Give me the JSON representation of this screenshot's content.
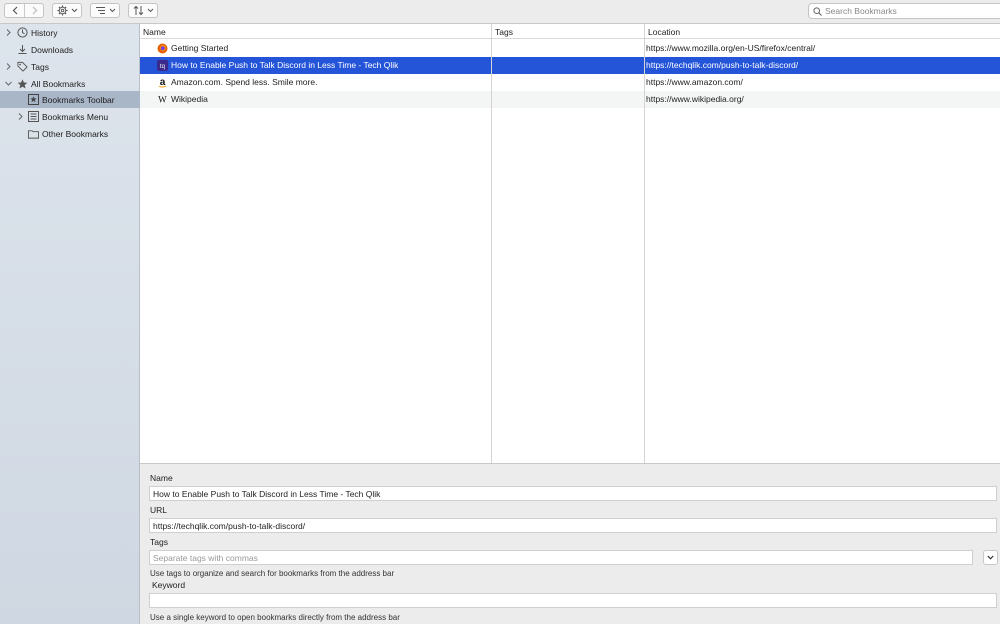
{
  "toolbar": {
    "back_icon": "chevron-left-icon",
    "forward_icon": "chevron-right-icon",
    "organize_icon": "gear-icon",
    "views_icon": "list-view-icon",
    "import_export_icon": "sort-arrows-icon",
    "search": {
      "placeholder": "Search Bookmarks",
      "value": ""
    }
  },
  "sidebar": {
    "items": [
      {
        "label": "History",
        "icon": "clock-icon",
        "disclosure": "collapsed"
      },
      {
        "label": "Downloads",
        "icon": "download-icon",
        "disclosure": "none"
      },
      {
        "label": "Tags",
        "icon": "tag-icon",
        "disclosure": "collapsed"
      },
      {
        "label": "All Bookmarks",
        "icon": "star-icon",
        "disclosure": "expanded"
      },
      {
        "label": "Bookmarks Toolbar",
        "icon": "bookmarks-toolbar-icon",
        "disclosure": "none",
        "selected": true
      },
      {
        "label": "Bookmarks Menu",
        "icon": "bookmarks-menu-icon",
        "disclosure": "collapsed"
      },
      {
        "label": "Other Bookmarks",
        "icon": "folder-icon",
        "disclosure": "none"
      }
    ]
  },
  "table": {
    "columns": [
      "Name",
      "Tags",
      "Location"
    ],
    "rows": [
      {
        "name": "Getting Started",
        "tags": "",
        "location": "https://www.mozilla.org/en-US/firefox/central/",
        "icon": "firefox-icon"
      },
      {
        "name": "How to Enable Push to Talk Discord in Less Time - Tech Qlik",
        "tags": "",
        "location": "https://techqlik.com/push-to-talk-discord/",
        "icon": "techqlik-icon",
        "selected": true
      },
      {
        "name": "Amazon.com. Spend less. Smile more.",
        "tags": "",
        "location": "https://www.amazon.com/",
        "icon": "amazon-icon"
      },
      {
        "name": "Wikipedia",
        "tags": "",
        "location": "https://www.wikipedia.org/",
        "icon": "wikipedia-icon"
      }
    ]
  },
  "details": {
    "name_label": "Name",
    "name_value": "How to Enable Push to Talk Discord in Less Time - Tech Qlik",
    "url_label": "URL",
    "url_value": "https://techqlik.com/push-to-talk-discord/",
    "tags_label": "Tags",
    "tags_placeholder": "Separate tags with commas",
    "tags_help": "Use tags to organize and search for bookmarks from the address bar",
    "keyword_label": "Keyword",
    "keyword_value": "",
    "keyword_help": "Use a single keyword to open bookmarks directly from the address bar"
  },
  "colors": {
    "selection": "#2455d9",
    "sidebar_selection": "#a8b6c8"
  }
}
